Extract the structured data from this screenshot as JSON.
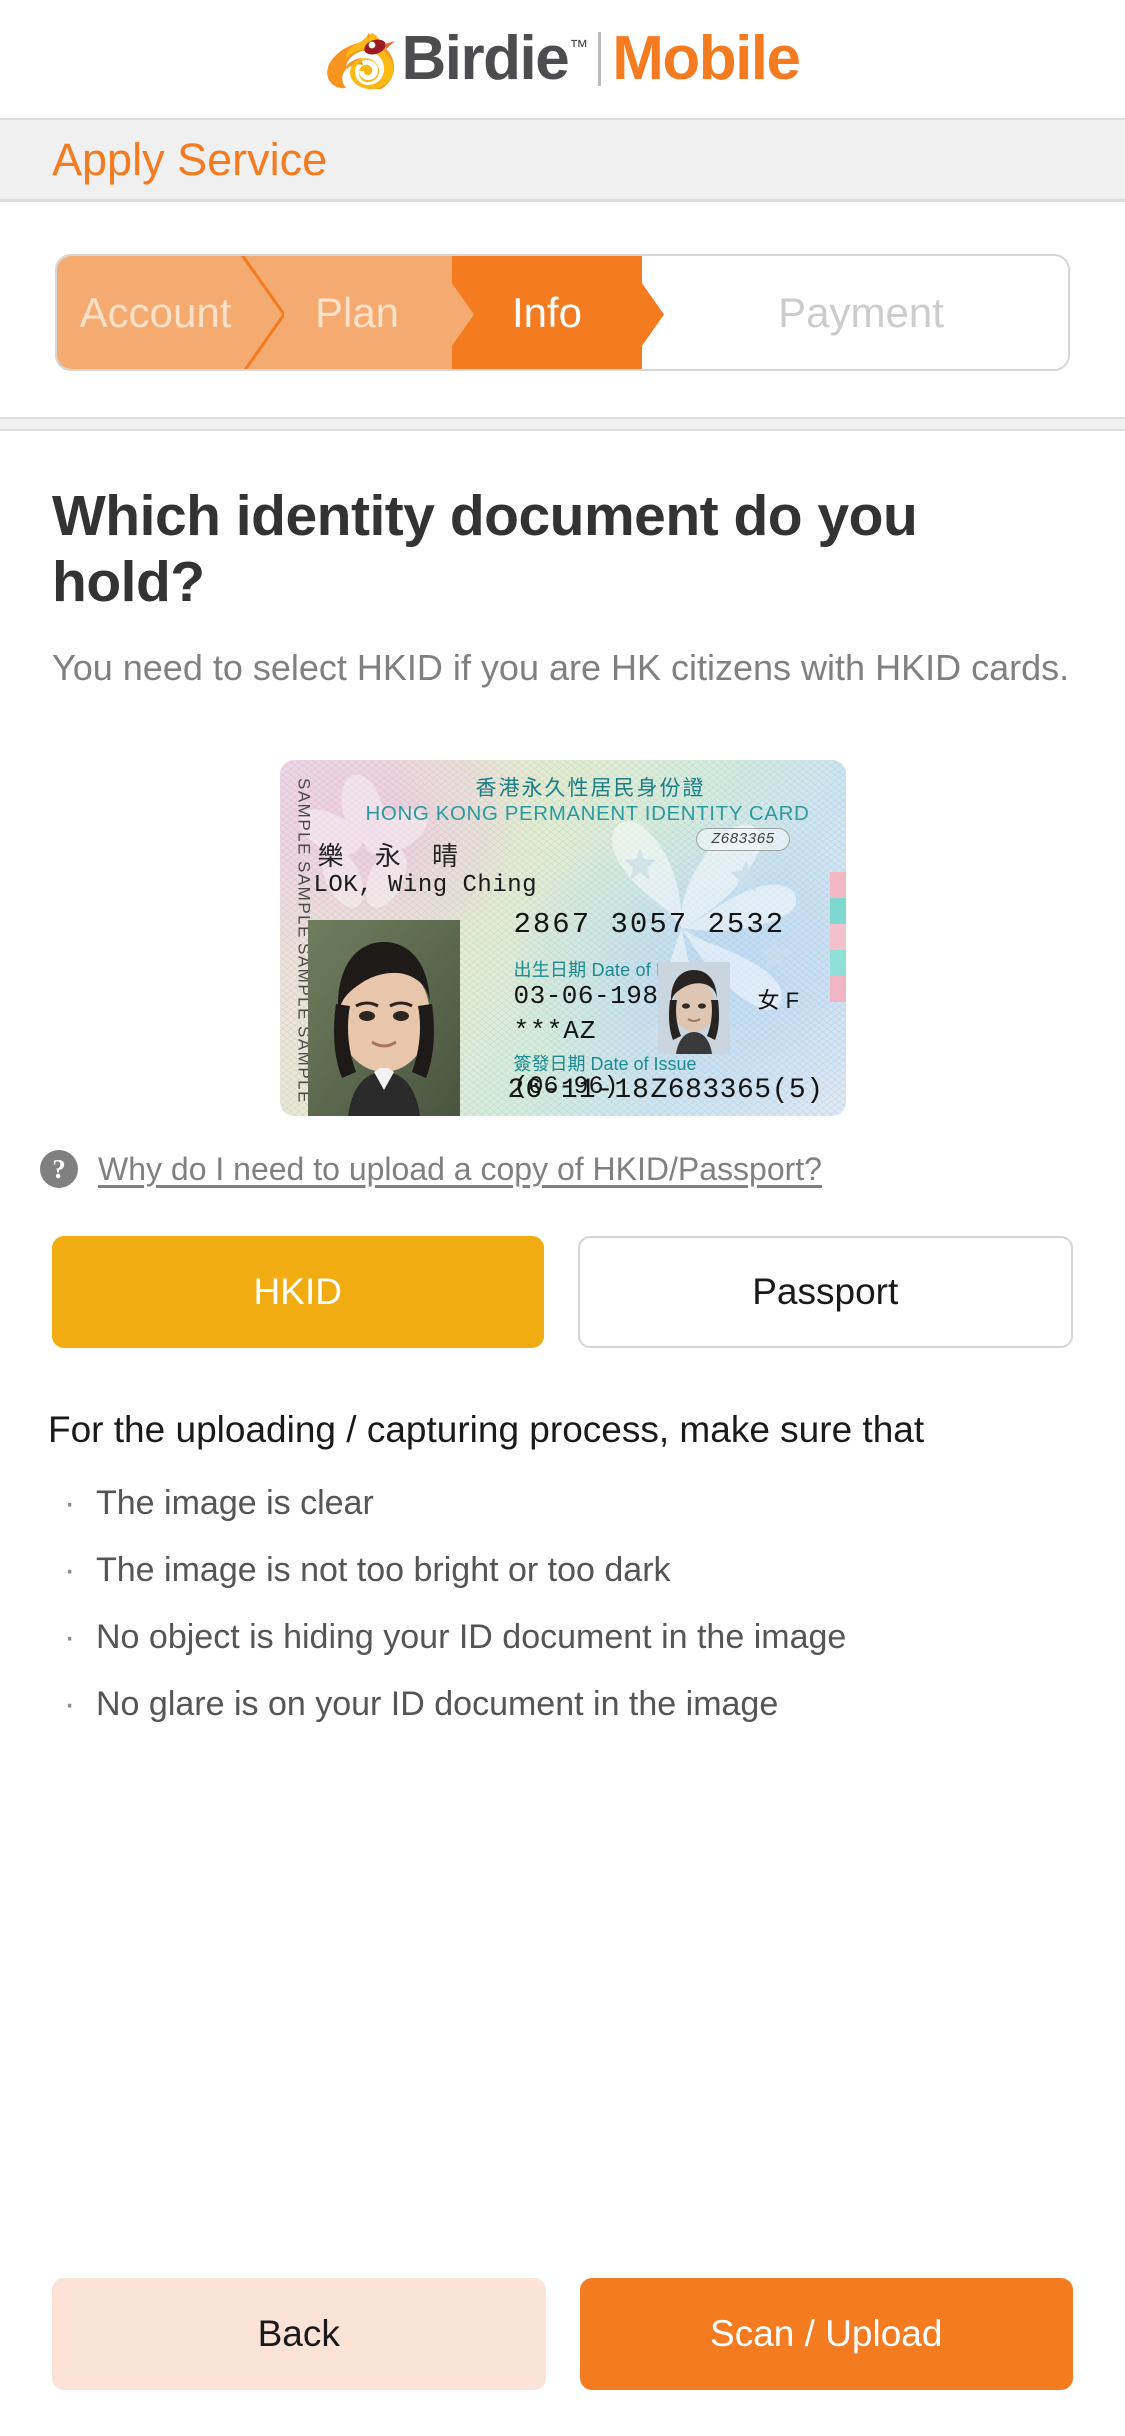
{
  "brand": {
    "name": "Birdie",
    "tm": "™",
    "product": "Mobile",
    "logo_icon": "bird-logo-icon",
    "colors": {
      "text_dark": "#4d4d4f",
      "orange": "#f47b20"
    }
  },
  "title_bar": {
    "text": "Apply Service"
  },
  "stepper": {
    "steps": [
      {
        "label": "Account",
        "state": "completed"
      },
      {
        "label": "Plan",
        "state": "completed"
      },
      {
        "label": "Info",
        "state": "active"
      },
      {
        "label": "Payment",
        "state": "upcoming"
      }
    ],
    "colors": {
      "completed": "#f5ab70",
      "active": "#f47b20",
      "upcoming": "#ffffff"
    }
  },
  "main": {
    "heading": "Which identity document do you hold?",
    "subtitle": "You need to select HKID if you are HK citizens with HKID cards."
  },
  "hkid_card": {
    "sample_marks": [
      "SAMPLE",
      "SAMPLE",
      "SAMPLE",
      "SAMPLE"
    ],
    "title_cn": "香港永久性居民身份證",
    "title_en": "HONG KONG PERMANENT IDENTITY CARD",
    "serial_top": "Z683365",
    "name_cn": "樂 永 晴",
    "name_en": "LOK, Wing Ching",
    "id_number": "2867 3057 2532",
    "label_dob": "出生日期 Date of Birth",
    "date_of_birth": "03-06-1985",
    "sex": "女 F",
    "codes": "***AZ",
    "label_doi": "簽發日期 Date of Issue",
    "date_of_issue_original": "(06-96)",
    "date_of_issue": "26-11-18",
    "id_number_bottom": "Z683365(5)"
  },
  "help": {
    "icon": "question-mark-circle-icon",
    "link_text": "Why do I need to upload a copy of HKID/Passport?"
  },
  "doc_type": {
    "options": [
      {
        "label": "HKID",
        "selected": true
      },
      {
        "label": "Passport",
        "selected": false
      }
    ],
    "selected_color": "#f0ac10"
  },
  "tips": {
    "title": "For the uploading / capturing process, make sure that",
    "bullet": "·",
    "items": [
      "The image is clear",
      "The image is not too bright or too dark",
      "No object is hiding your ID document in the image",
      "No glare is on your ID document in the image"
    ]
  },
  "footer": {
    "back_label": "Back",
    "primary_label": "Scan / Upload",
    "primary_color": "#f47b20",
    "back_color": "#fce3d7"
  }
}
